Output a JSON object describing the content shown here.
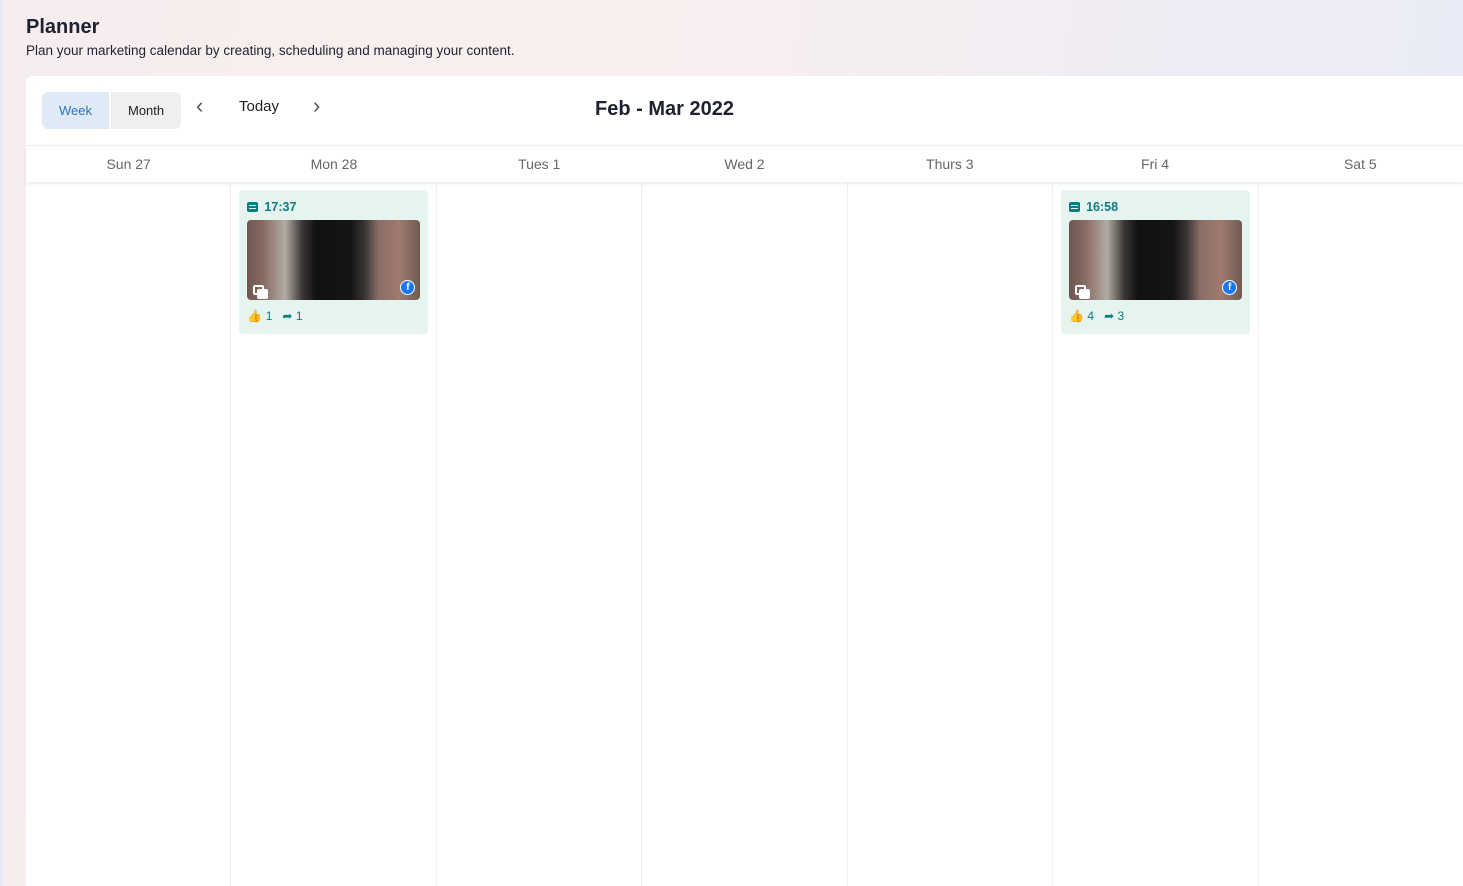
{
  "header": {
    "title": "Planner",
    "subtitle": "Plan your marketing calendar by creating, scheduling and managing your content."
  },
  "toolbar": {
    "week": "Week",
    "month": "Month",
    "prev": "‹",
    "today": "Today",
    "next": "›",
    "range": "Feb - Mar 2022"
  },
  "days": [
    "Sun 27",
    "Mon 28",
    "Tues 1",
    "Wed 2",
    "Thurs 3",
    "Fri 4",
    "Sat 5"
  ],
  "posts": [
    {
      "time": "17:37",
      "likes": "1",
      "shares": "1",
      "network": "f"
    },
    {
      "time": "16:58",
      "likes": "4",
      "shares": "3",
      "network": "f"
    }
  ]
}
